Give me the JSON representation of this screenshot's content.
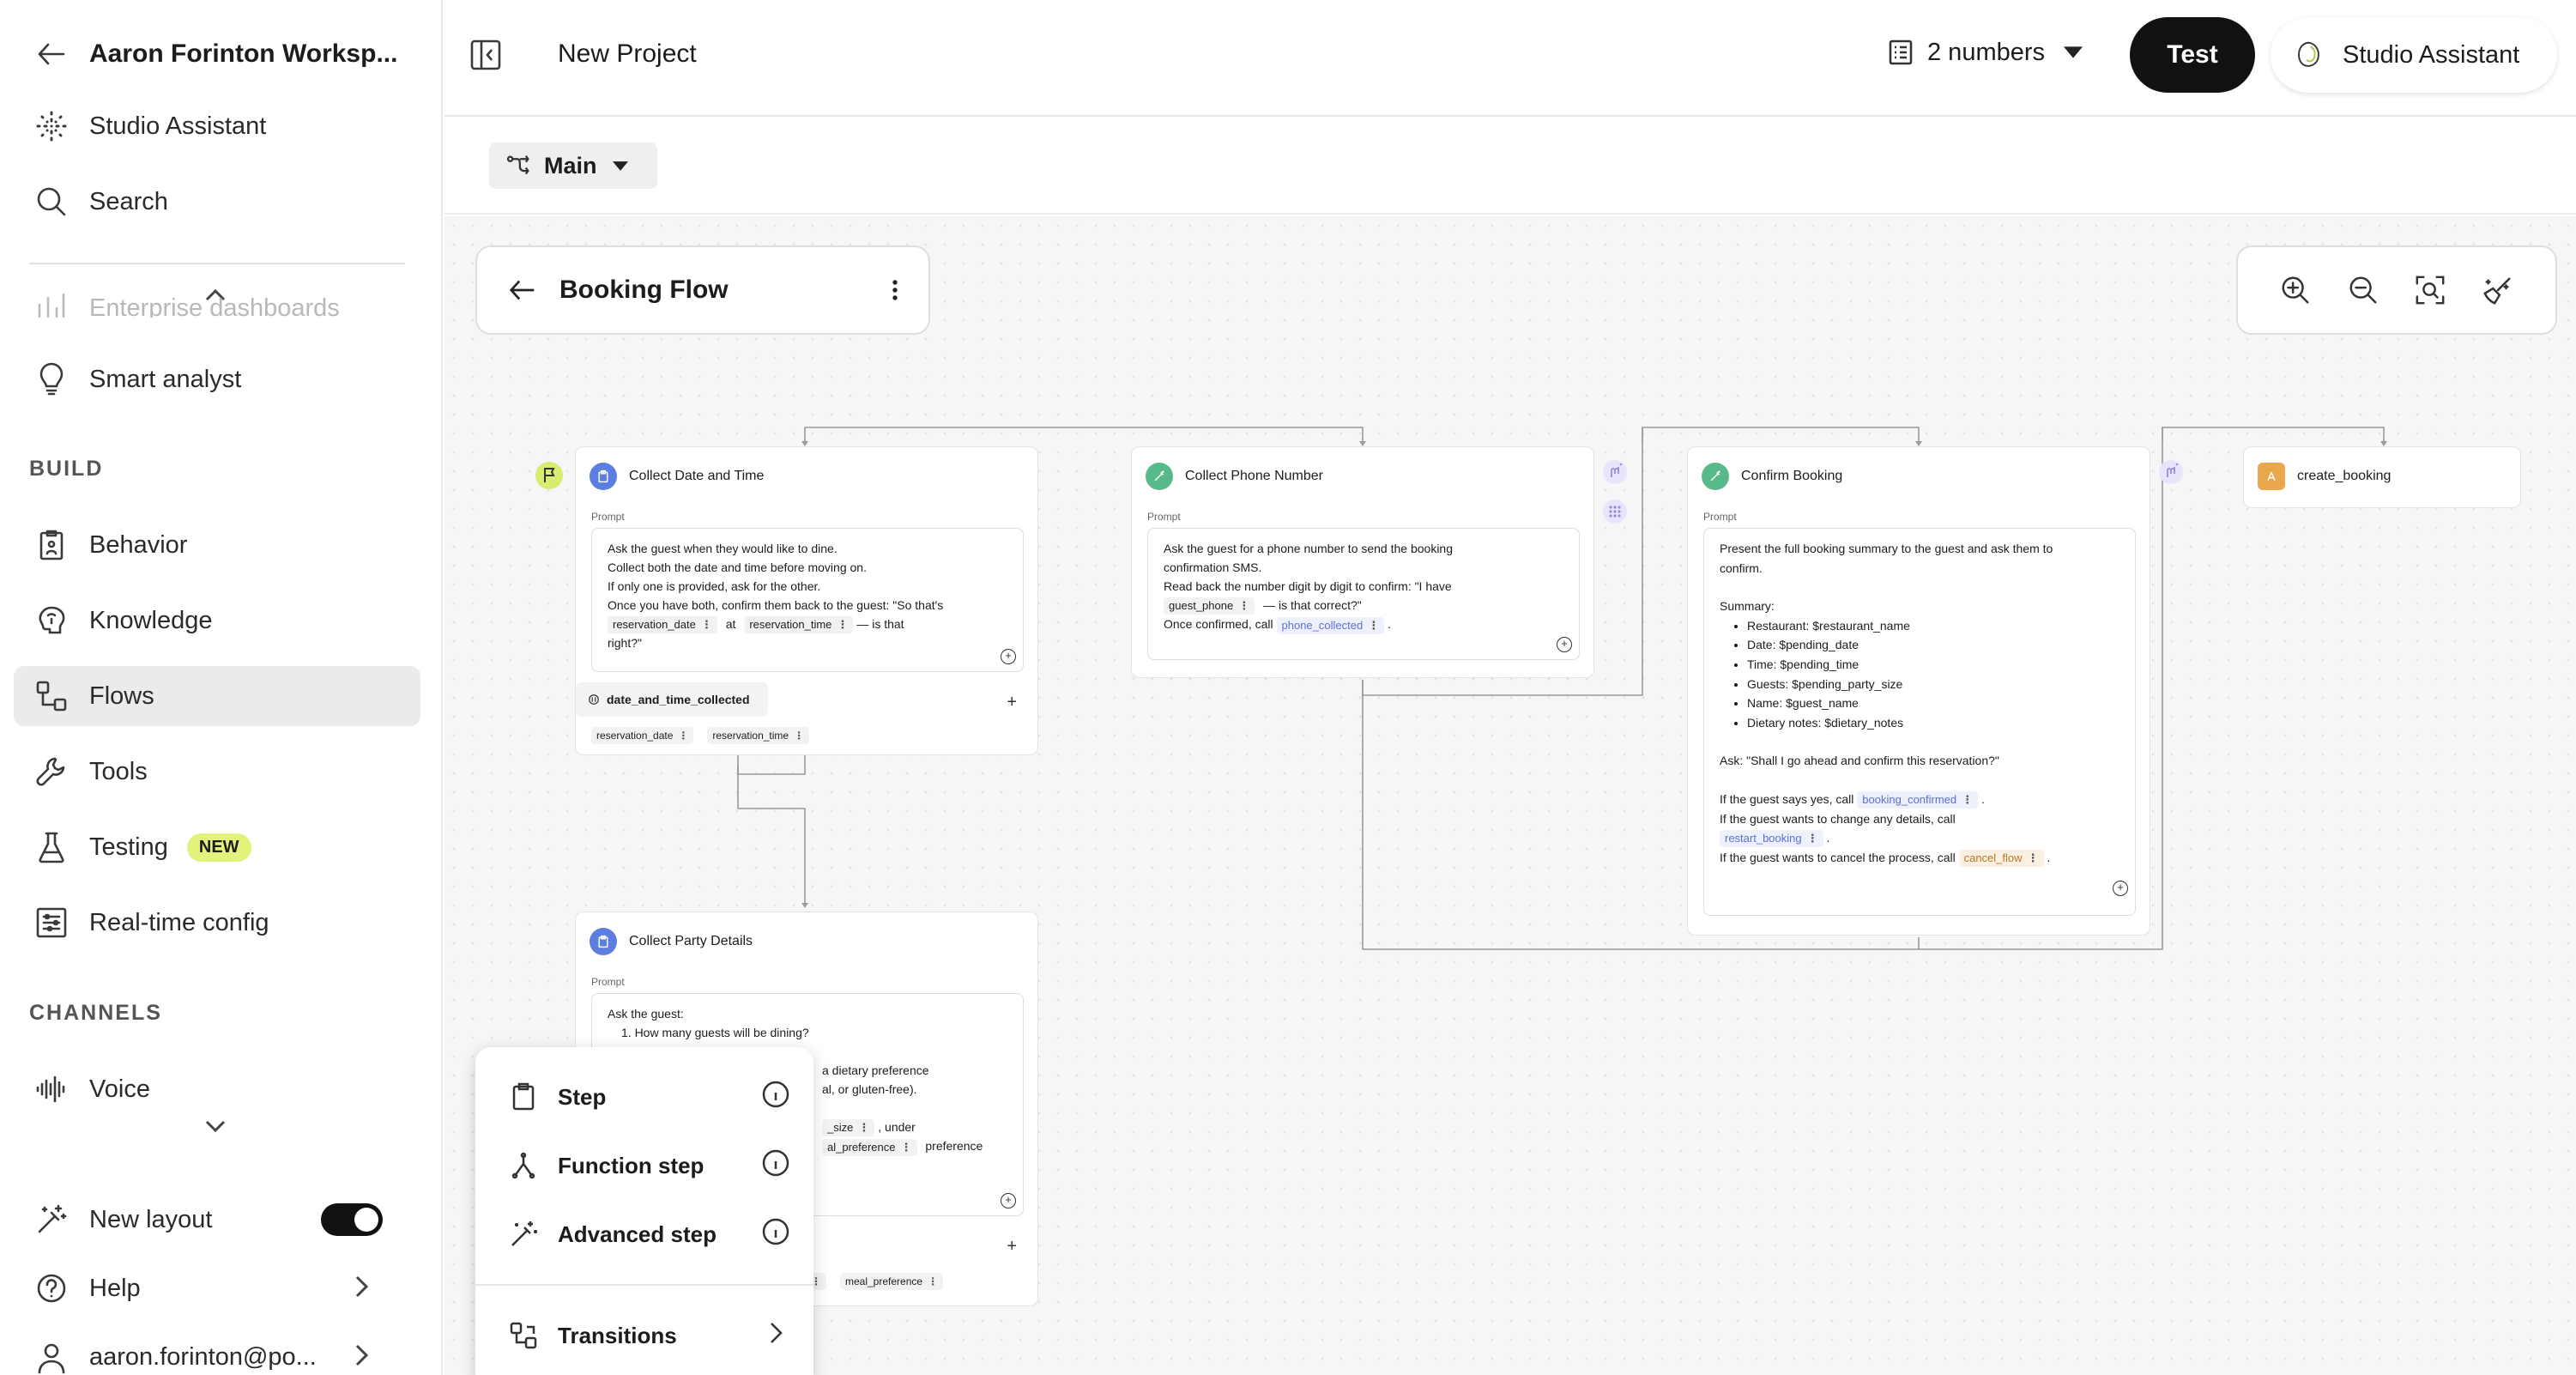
{
  "sidebar": {
    "workspace_title": "Aaron Forinton Worksp...",
    "items": {
      "studio_assistant": "Studio Assistant",
      "search": "Search",
      "enterprise_dashboards": "Enterprise dashboards",
      "smart_analyst": "Smart analyst",
      "behavior": "Behavior",
      "knowledge": "Knowledge",
      "flows": "Flows",
      "tools": "Tools",
      "testing": "Testing",
      "realtime_config": "Real-time config",
      "voice": "Voice",
      "new_layout": "New layout",
      "help": "Help",
      "user": "aaron.forinton@po..."
    },
    "section_build": "BUILD",
    "section_channels": "CHANNELS",
    "testing_badge": "NEW"
  },
  "topbar": {
    "project_title": "New Project",
    "numbers_label": "2 numbers",
    "test_label": "Test",
    "assistant_label": "Studio Assistant"
  },
  "subbar": {
    "main_label": "Main"
  },
  "flow": {
    "title": "Booking Flow"
  },
  "nodes": {
    "collect_date": {
      "title": "Collect Date and Time",
      "prompt_label": "Prompt",
      "lines": [
        "Ask the guest when they would like to dine.",
        "Collect both the date and time before moving on.",
        "If only one is provided, ask for the other.",
        "Once you have both, confirm them back to the guest: \"So that's"
      ],
      "chip_date": "reservation_date",
      "word_at": "at",
      "chip_time": "reservation_time",
      "tail": "— is that",
      "last": "right?\"",
      "function_chip": "date_and_time_collected",
      "out_chip_1": "reservation_date",
      "out_chip_2": "reservation_time"
    },
    "collect_phone": {
      "title": "Collect Phone Number",
      "prompt_label": "Prompt",
      "line1": "Ask the guest for a phone number to send the booking",
      "line2": "confirmation SMS.",
      "line3": "Read back the number digit by digit to confirm: \"I have",
      "chip_phone": "guest_phone",
      "tail": "— is that correct?\"",
      "line5": "Once confirmed, call",
      "chip_collected": "phone_collected",
      "dot": "."
    },
    "confirm_booking": {
      "title": "Confirm Booking",
      "prompt_label": "Prompt",
      "line1": "Present the full booking summary to the guest and ask them to",
      "line2": "confirm.",
      "summary": "Summary:",
      "bullets": [
        "Restaurant: $restaurant_name",
        "Date: $pending_date",
        "Time: $pending_time",
        "Guests: $pending_party_size",
        "Name: $guest_name",
        "Dietary notes: $dietary_notes"
      ],
      "ask": "Ask: \"Shall I go ahead and confirm this reservation?\"",
      "if_yes": "If the guest says yes, call",
      "chip_confirmed": "booking_confirmed",
      "if_change": "If the guest wants to change any details, call",
      "chip_restart": "restart_booking",
      "if_cancel": "If the guest wants to cancel the process, call",
      "chip_cancel": "cancel_flow",
      "dot": "."
    },
    "create_booking": {
      "title": "create_booking"
    },
    "collect_party": {
      "title": "Collect Party Details",
      "prompt_label": "Prompt",
      "line1": "Ask the guest:",
      "line2": "1. How many guests will be dining?",
      "line3": "a dietary preference",
      "line4": "al, or gluten-free).",
      "chip_size": "_size",
      "under": ", under",
      "chip_meal": "al_preference",
      "pref": "preference",
      "out_chip": "meal_preference"
    }
  },
  "popup": {
    "step": "Step",
    "function_step": "Function step",
    "advanced_step": "Advanced step",
    "transitions": "Transitions"
  },
  "colors": {
    "accent_new": "#e3f27a",
    "node_blue": "#5b7ee0",
    "node_green": "#58b98a",
    "node_orange": "#e9a84b",
    "node_purple": "#a99ae8"
  }
}
